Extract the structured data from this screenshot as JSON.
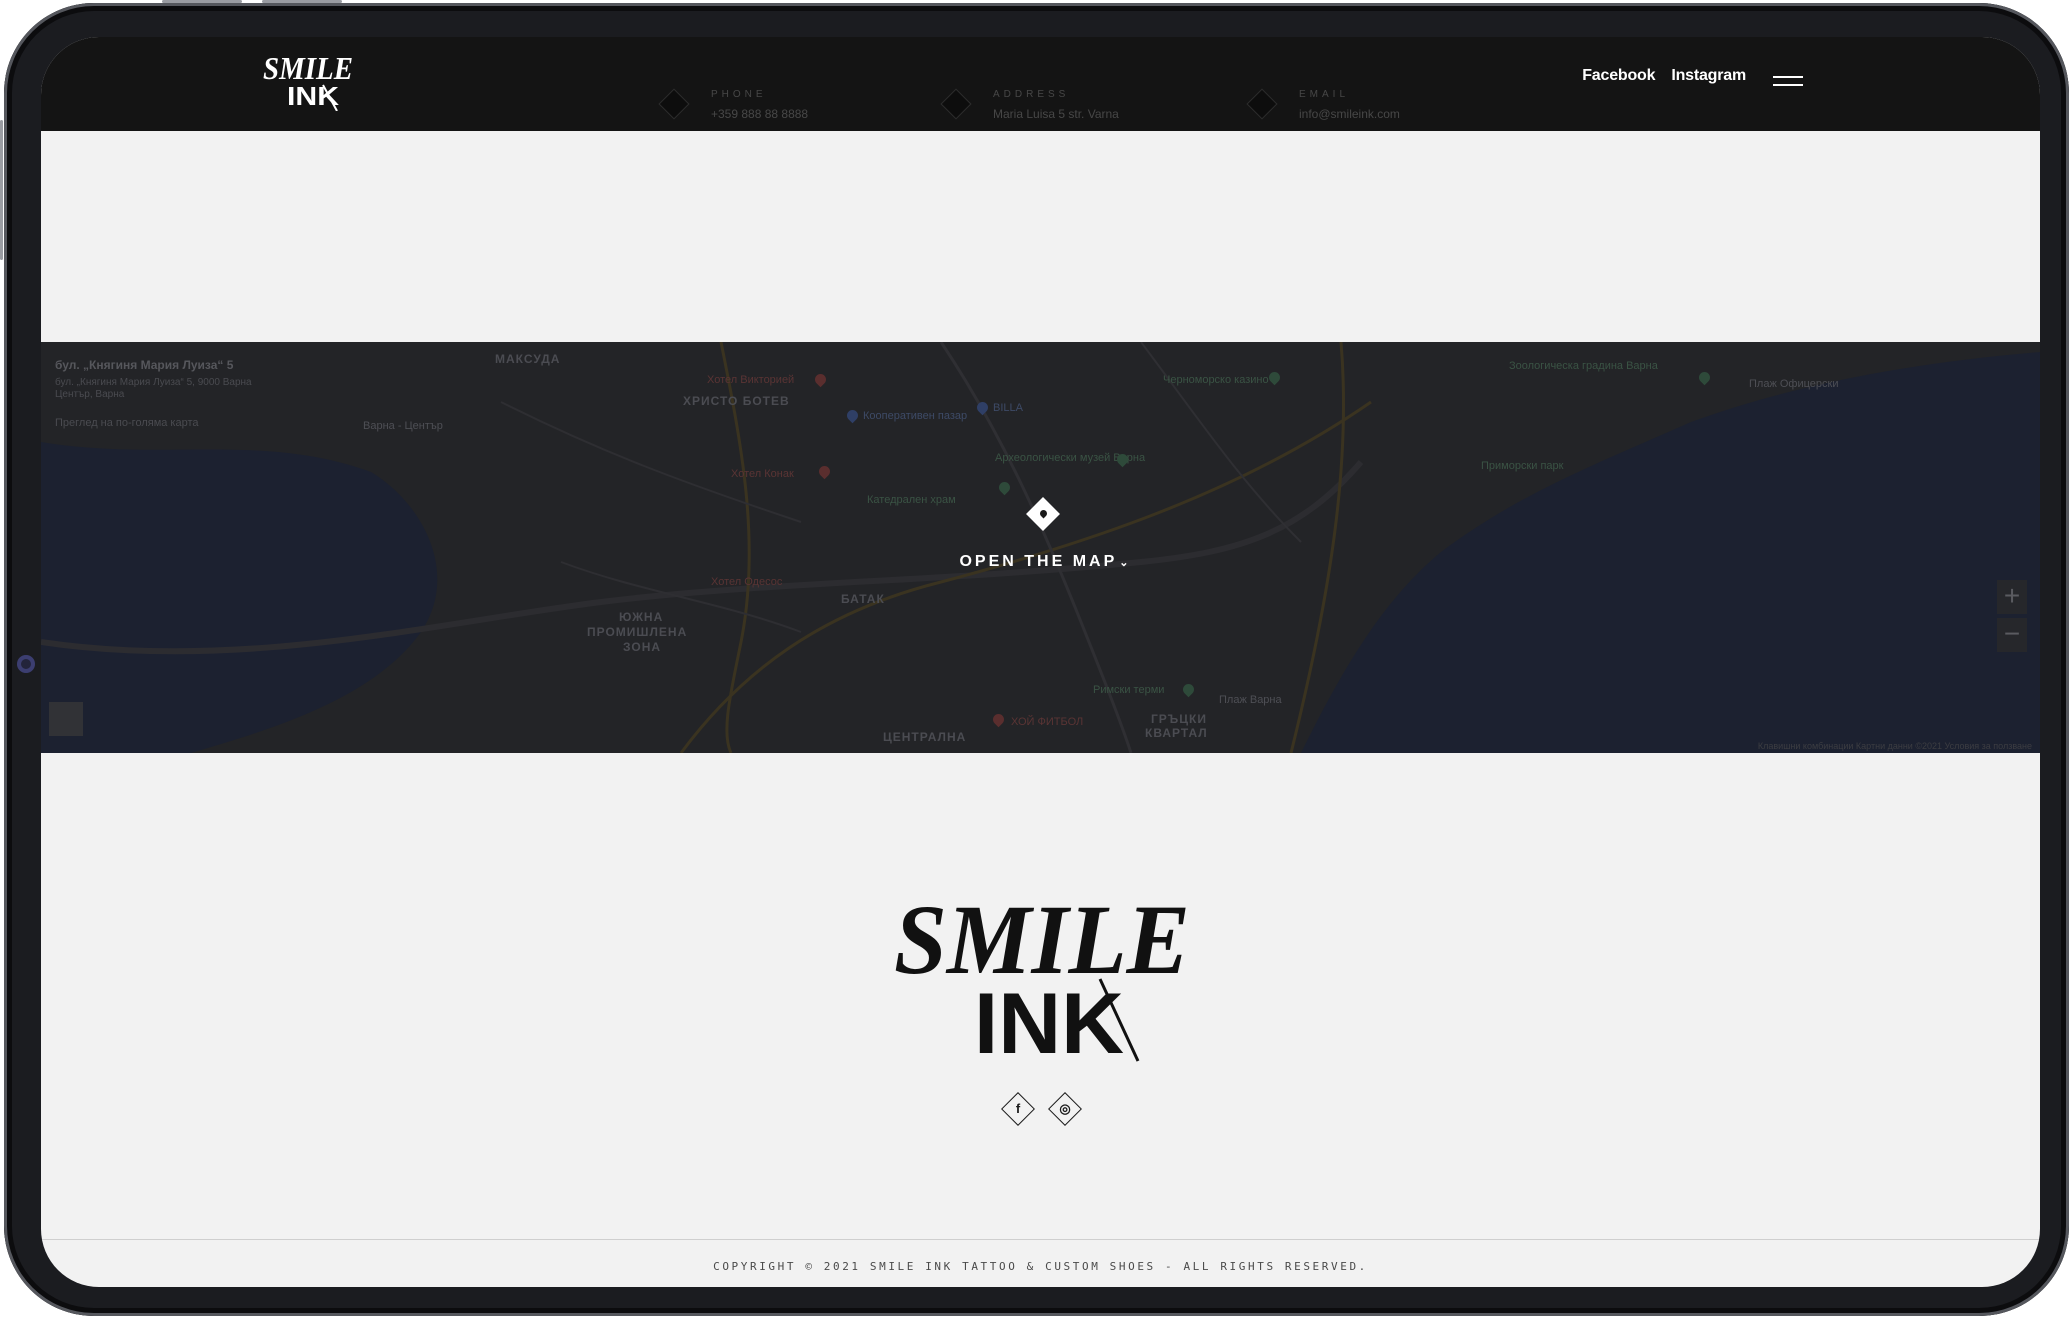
{
  "header": {
    "logo_line1": "SMILE",
    "logo_line2": "INK",
    "nav": [
      {
        "label": "Facebook"
      },
      {
        "label": "Instagram"
      }
    ],
    "contacts": [
      {
        "label": "PHONE",
        "value": "+359 888 88 8888",
        "icon": "phone-icon"
      },
      {
        "label": "ADDRESS",
        "value": "Maria Luisa 5 str. Varna",
        "icon": "location-icon"
      },
      {
        "label": "EMAIL",
        "value": "info@smileink.com",
        "icon": "email-icon"
      }
    ]
  },
  "map": {
    "info_title": "бул. „Княгиня Мария Луиза“ 5",
    "info_address": "бул. „Княгиня Мария Луиза“ 5, 9000 Варна Център, Варна",
    "info_link": "Преглед на по-голяма карта",
    "open_label": "OPEN THE MAP",
    "zoom_in": "+",
    "zoom_out": "−",
    "places": [
      {
        "text": "МАКСУДА",
        "kind": "dist"
      },
      {
        "text": "ХРИСТО БОТЕВ",
        "kind": "dist"
      },
      {
        "text": "ЮЖНА",
        "kind": "dist"
      },
      {
        "text": "ПРОМИШЛЕНА",
        "kind": "dist"
      },
      {
        "text": "ЗОНА",
        "kind": "dist"
      },
      {
        "text": "БАТАК",
        "kind": "dist"
      },
      {
        "text": "ЦЕНТРАЛНА",
        "kind": "dist"
      },
      {
        "text": "ГРЪЦКИ",
        "kind": "dist"
      },
      {
        "text": "КВАРТАЛ",
        "kind": "dist"
      },
      {
        "text": "Хотел Викторией",
        "kind": "red"
      },
      {
        "text": "Хотел Конак",
        "kind": "red"
      },
      {
        "text": "Хотел Одесос",
        "kind": "red"
      },
      {
        "text": "ХОЙ ФИТБОЛ",
        "kind": "red"
      },
      {
        "text": "Кооперативен пазар",
        "kind": "blue"
      },
      {
        "text": "BILLA",
        "kind": "blue"
      },
      {
        "text": "Археологически музей Варна",
        "kind": "green"
      },
      {
        "text": "Приморски парк",
        "kind": "green"
      },
      {
        "text": "Варна - Център",
        "kind": "plain"
      },
      {
        "text": "Римски терми",
        "kind": "green"
      },
      {
        "text": "Плаж Варна",
        "kind": "plain"
      },
      {
        "text": "Катедрален храм",
        "kind": "green"
      },
      {
        "text": "Черноморско казино",
        "kind": "green"
      },
      {
        "text": "Зоологическа градина Варна",
        "kind": "green"
      },
      {
        "text": "Плаж Офицерски",
        "kind": "plain"
      }
    ],
    "attribution": "Клавишни комбинации  Картни данни ©2021  Условия за ползване"
  },
  "footer": {
    "logo_line1": "SMILE",
    "logo_line2": "INK",
    "social": [
      {
        "name": "facebook",
        "glyph": "f"
      },
      {
        "name": "instagram",
        "glyph": "◎"
      }
    ],
    "copyright": "COPYRIGHT © 2021 SMILE INK TATTOO & CUSTOM SHOES - ALL RIGHTS RESERVED."
  }
}
